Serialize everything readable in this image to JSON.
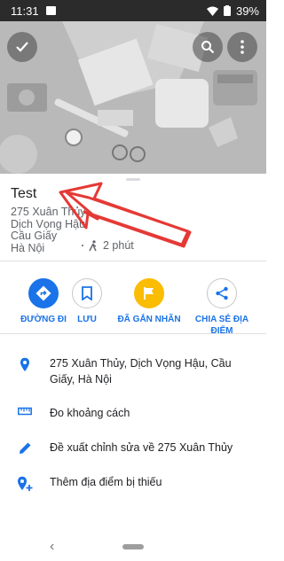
{
  "status_bar": {
    "time": "11:31",
    "battery": "39%"
  },
  "place": {
    "title": "Test",
    "address_lines": [
      "275 Xuân Thủy",
      "Dịch Vọng Hậu",
      "Cầu Giấy",
      "Hà Nội"
    ],
    "walk_time": "2 phút"
  },
  "actions": [
    {
      "label": "ĐƯỜNG ĐI",
      "icon": "directions-icon"
    },
    {
      "label": "LƯU",
      "icon": "bookmark-icon"
    },
    {
      "label": "ĐÃ GẮN NHÃN",
      "icon": "flag-icon"
    },
    {
      "label": "CHIA SẺ ĐỊA ĐIỂM",
      "icon": "share-icon"
    }
  ],
  "details": [
    {
      "text": "275 Xuân Thủy, Dịch Vọng Hậu, Cầu Giấy, Hà Nội",
      "icon": "location-pin-icon"
    },
    {
      "text": "Đo khoảng cách",
      "icon": "ruler-icon"
    },
    {
      "text": "Đề xuất chỉnh sửa về 275 Xuân Thủy",
      "icon": "pencil-icon"
    },
    {
      "text": "Thêm địa điểm bị thiếu",
      "icon": "add-location-icon"
    }
  ],
  "colors": {
    "accent": "#1a73e8",
    "saved": "#fbbc04",
    "arrow": "#e53935"
  }
}
